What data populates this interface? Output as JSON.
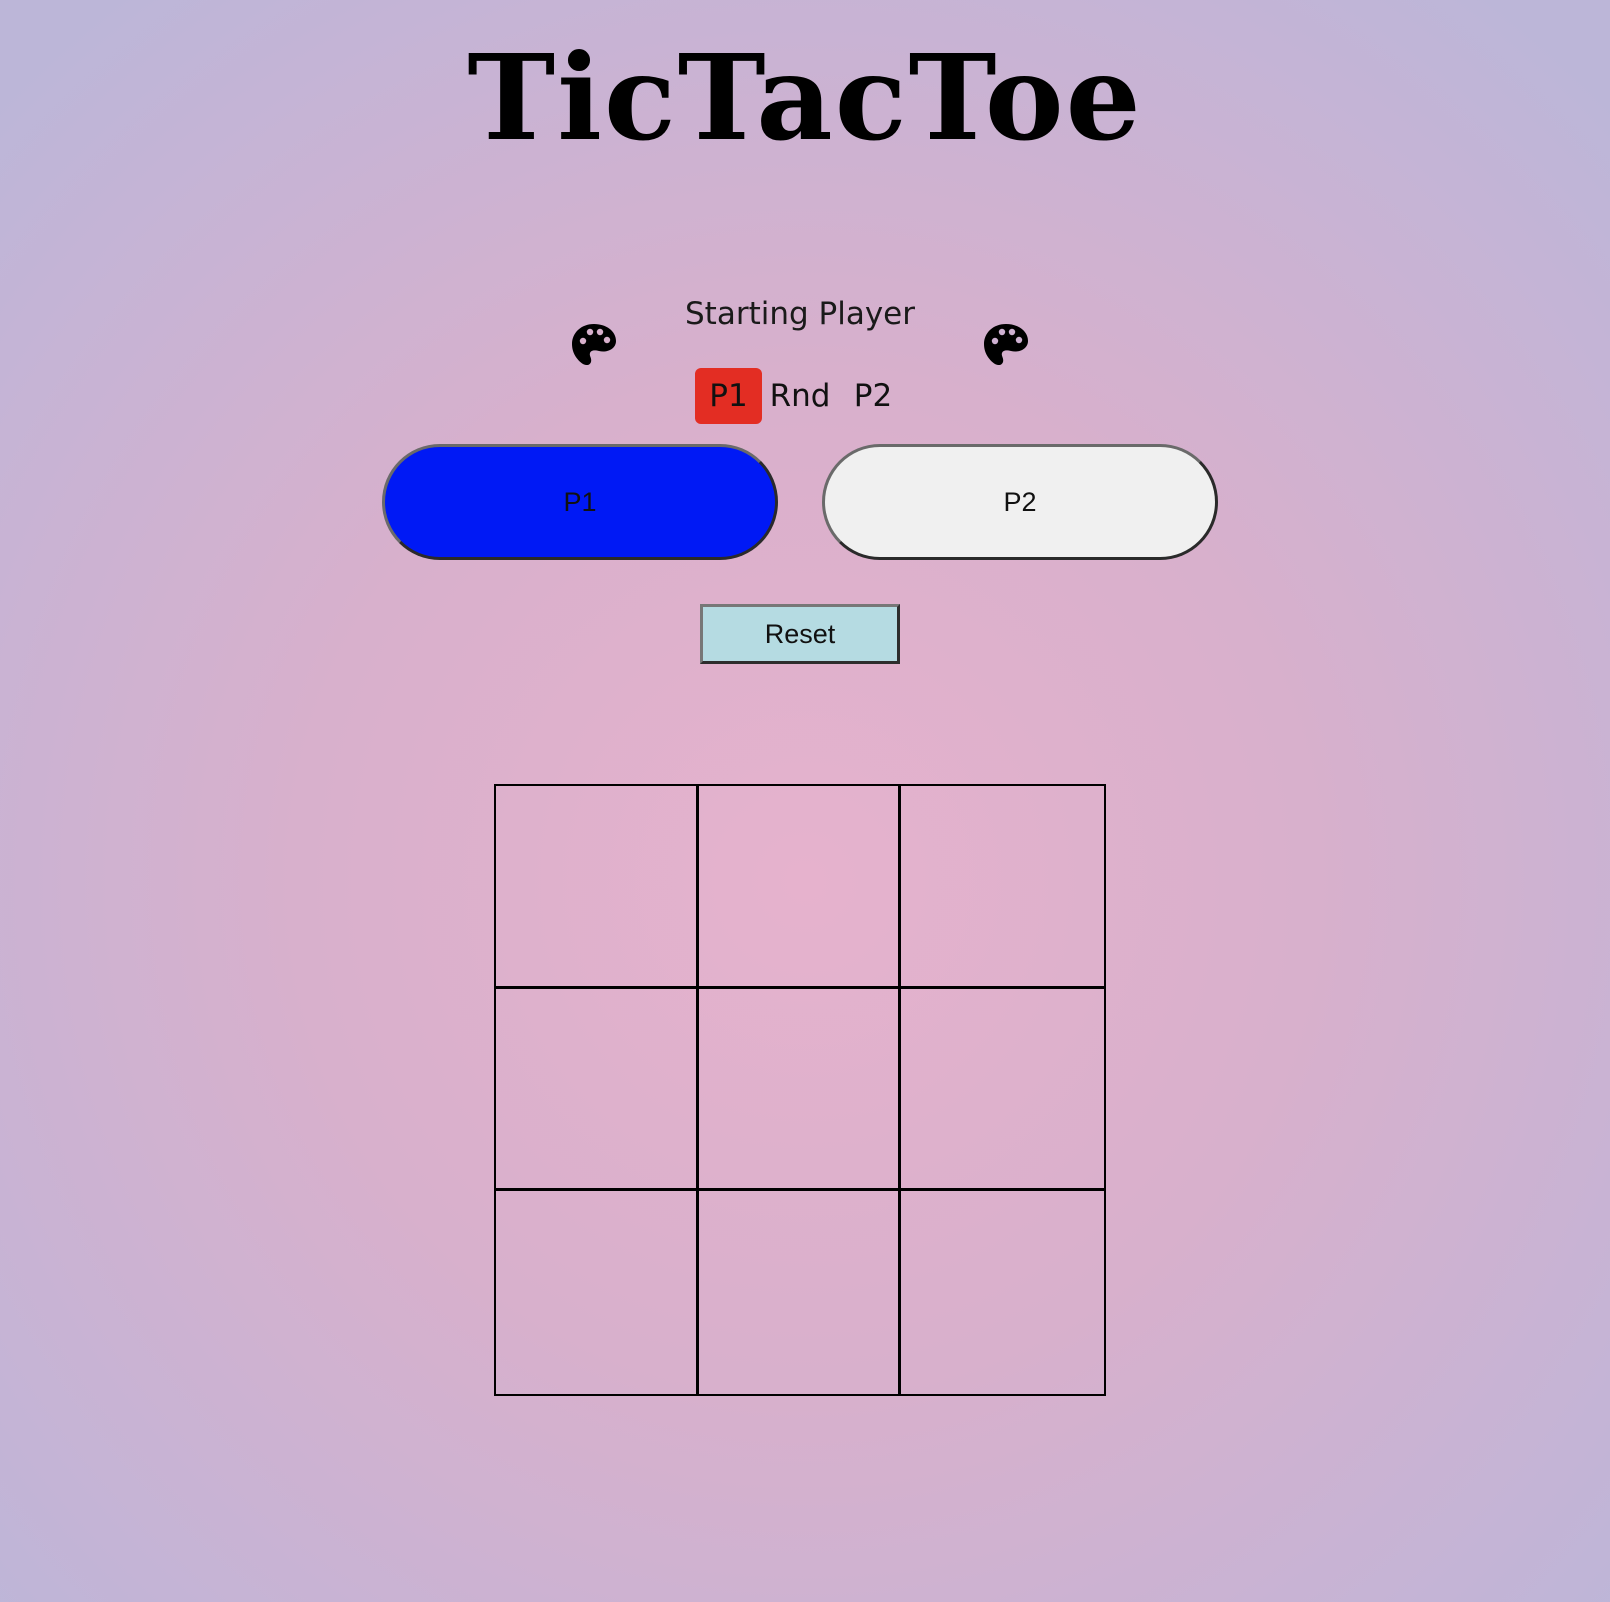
{
  "header": {
    "title": "TicTacToe"
  },
  "starting_player": {
    "label": "Starting Player",
    "options": [
      {
        "label": "P1",
        "selected": true
      },
      {
        "label": "Rnd",
        "selected": false
      },
      {
        "label": "P2",
        "selected": false
      }
    ],
    "selected_color": "#e32d23"
  },
  "players": [
    {
      "label": "P1",
      "color": "#0019f5"
    },
    {
      "label": "P2",
      "color": "#f0f0f0"
    }
  ],
  "icons": {
    "left_palette": "palette-icon",
    "right_palette": "palette-icon"
  },
  "controls": {
    "reset_label": "Reset",
    "reset_color": "#b5dbe2"
  },
  "board": {
    "rows": 3,
    "cols": 3,
    "cells": [
      "",
      "",
      "",
      "",
      "",
      "",
      "",
      "",
      ""
    ]
  }
}
